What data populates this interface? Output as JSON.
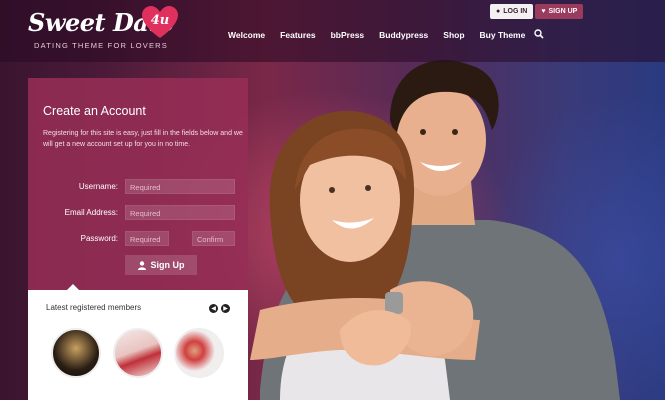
{
  "brand": {
    "name": "Sweet Date",
    "badge": "4u",
    "tagline": "DATING THEME FOR LOVERS"
  },
  "auth": {
    "login_label": "LOG IN",
    "signup_label": "SIGN UP"
  },
  "nav": {
    "items": [
      "Welcome",
      "Features",
      "bbPress",
      "Buddypress",
      "Shop",
      "Buy Theme"
    ],
    "search_icon": "search-icon"
  },
  "form": {
    "title": "Create an Account",
    "intro": "Registering for this site is easy, just fill in the fields below and we will get a new account set up for you in no time.",
    "username_label": "Username:",
    "username_placeholder": "Required",
    "email_label": "Email Address:",
    "email_placeholder": "Required",
    "password_label": "Password:",
    "password_placeholder": "Required",
    "confirm_placeholder": "Confirm",
    "submit_label": "Sign Up"
  },
  "members": {
    "title": "Latest registered members",
    "prev_icon": "arrow-left-icon",
    "next_icon": "arrow-right-icon"
  },
  "colors": {
    "accent": "#9a3a5c",
    "panel": "#962d55"
  }
}
